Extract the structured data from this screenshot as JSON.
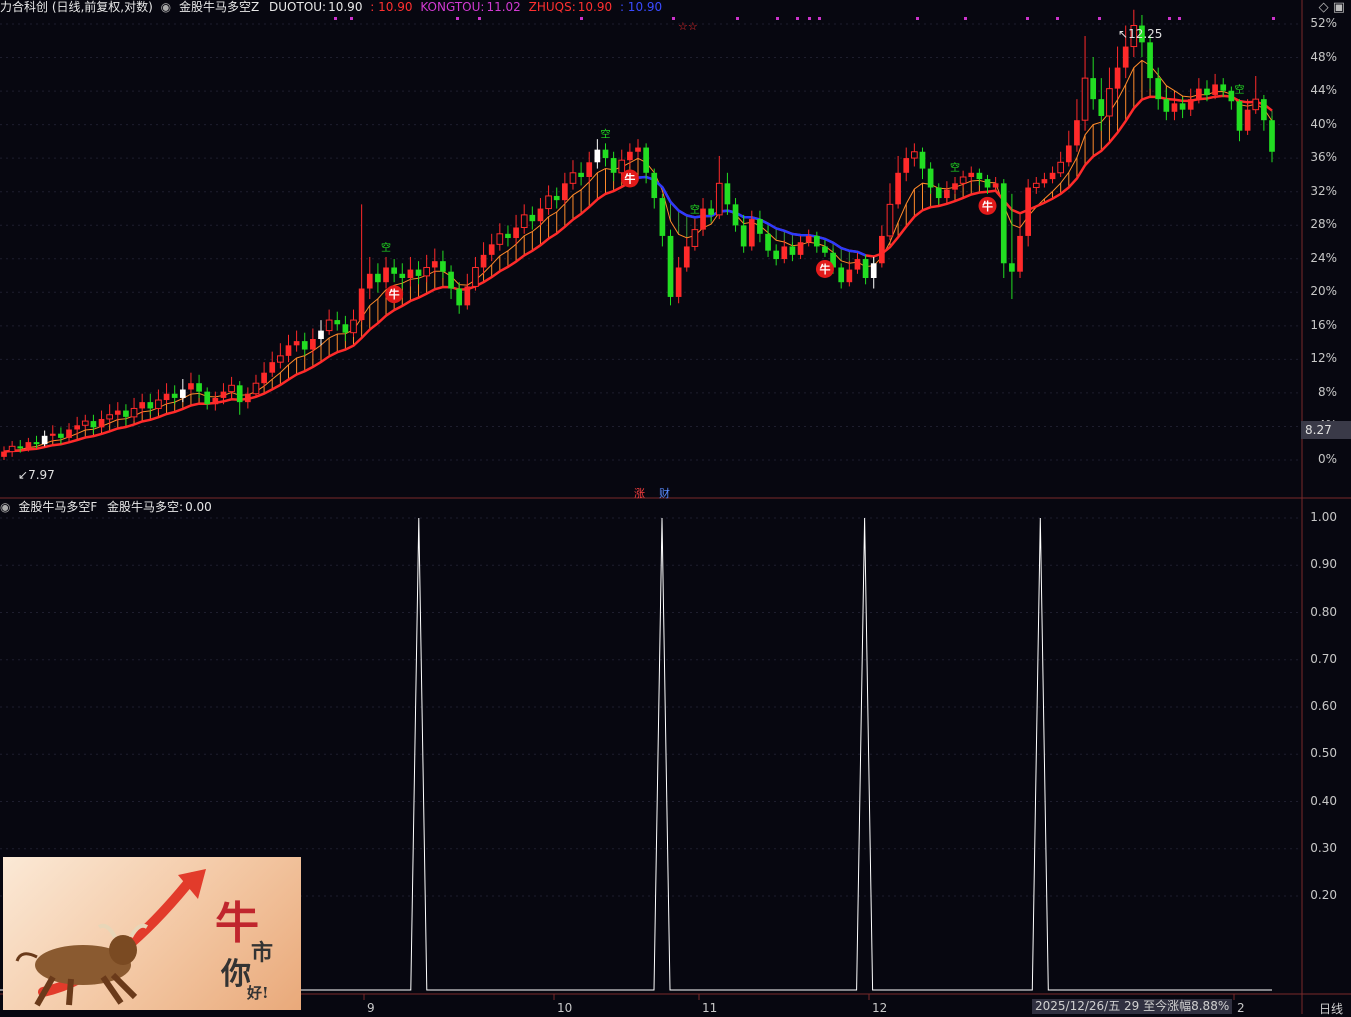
{
  "main_header": {
    "stock_title": "力合科创 (日线,前复权,对数)",
    "indicator_name": "金股牛马多空Z",
    "duotou_label": "DUOTOU:",
    "duotou_value": "10.90",
    "sep1": ": 10.90",
    "kongtou_label": "KONGTOU:",
    "kongtou_value": "11.02",
    "zhuqs_label": "ZHUQS:",
    "zhuqs_value": "10.90",
    "sep2": ": 10.90"
  },
  "sub_header": {
    "indicator_name": "金股牛马多空F",
    "value_label": "金股牛马多空:",
    "value": "0.00"
  },
  "price_axis_labels": [
    "52%",
    "48%",
    "44%",
    "40%",
    "36%",
    "32%",
    "28%",
    "24%",
    "20%",
    "16%",
    "12%",
    "8%",
    "4%",
    "0%"
  ],
  "current_price_badge": "8.27",
  "sub_axis_labels": [
    "1.00",
    "0.90",
    "0.80",
    "0.70",
    "0.60",
    "0.50",
    "0.40",
    "0.30",
    "0.20"
  ],
  "annotations": {
    "high_label": "12.25",
    "low_label": "7.97",
    "bull_marker": "牛",
    "kong_marker": "空",
    "stars": "☆☆",
    "zhang_tag": "涨",
    "cai_tag": "财"
  },
  "date_axis": {
    "labels": [
      "9",
      "10",
      "11",
      "12",
      "2"
    ],
    "status_text": "2025/12/26/五 29 至今涨幅8.88%",
    "period_button": "日线"
  },
  "promo": {
    "char1": "牛",
    "char2": "市",
    "char3": "你",
    "char4": "好!"
  },
  "colors": {
    "up": "#ff2a2a",
    "down": "#22dd22",
    "flat_white": "#ffffff",
    "magenta": "#cc33cc",
    "blue": "#2a3cff",
    "orange": "#ff8a2a"
  },
  "chart_data": [
    {
      "type": "candlestick",
      "title": "力合科创 (日线,前复权,对数)",
      "y_axis": "percent change",
      "ylim": [
        0,
        52
      ],
      "high_marker": 12.25,
      "low_marker": 7.97,
      "current": 8.27,
      "candles": [
        [
          8.0,
          8.05,
          7.97,
          8.1
        ],
        [
          8.05,
          8.1,
          8.0,
          8.15
        ],
        [
          8.1,
          8.08,
          8.04,
          8.16
        ],
        [
          8.08,
          8.14,
          8.05,
          8.18
        ],
        [
          8.14,
          8.12,
          8.08,
          8.2
        ],
        [
          8.12,
          8.2,
          8.1,
          8.25
        ],
        [
          8.2,
          8.22,
          8.15,
          8.3
        ],
        [
          8.22,
          8.18,
          8.12,
          8.28
        ],
        [
          8.18,
          8.26,
          8.15,
          8.32
        ],
        [
          8.26,
          8.3,
          8.2,
          8.38
        ],
        [
          8.3,
          8.34,
          8.26,
          8.4
        ],
        [
          8.34,
          8.28,
          8.22,
          8.4
        ],
        [
          8.28,
          8.36,
          8.24,
          8.44
        ],
        [
          8.36,
          8.4,
          8.3,
          8.5
        ],
        [
          8.4,
          8.44,
          8.34,
          8.52
        ],
        [
          8.44,
          8.38,
          8.3,
          8.5
        ],
        [
          8.38,
          8.46,
          8.34,
          8.56
        ],
        [
          8.46,
          8.52,
          8.4,
          8.6
        ],
        [
          8.52,
          8.46,
          8.4,
          8.6
        ],
        [
          8.46,
          8.54,
          8.42,
          8.64
        ],
        [
          8.54,
          8.6,
          8.5,
          8.7
        ],
        [
          8.6,
          8.56,
          8.5,
          8.68
        ],
        [
          8.56,
          8.64,
          8.52,
          8.74
        ],
        [
          8.64,
          8.7,
          8.6,
          8.8
        ],
        [
          8.7,
          8.62,
          8.56,
          8.78
        ],
        [
          8.62,
          8.5,
          8.45,
          8.66
        ],
        [
          8.5,
          8.56,
          8.44,
          8.62
        ],
        [
          8.56,
          8.62,
          8.5,
          8.7
        ],
        [
          8.62,
          8.68,
          8.56,
          8.76
        ],
        [
          8.68,
          8.52,
          8.4,
          8.72
        ],
        [
          8.52,
          8.6,
          8.46,
          8.66
        ],
        [
          8.6,
          8.7,
          8.56,
          8.78
        ],
        [
          8.7,
          8.8,
          8.66,
          8.9
        ],
        [
          8.8,
          8.9,
          8.76,
          9.0
        ],
        [
          8.9,
          8.96,
          8.84,
          9.08
        ],
        [
          8.96,
          9.06,
          8.9,
          9.16
        ],
        [
          9.06,
          9.1,
          9.0,
          9.2
        ],
        [
          9.1,
          9.02,
          8.96,
          9.18
        ],
        [
          9.02,
          9.12,
          8.98,
          9.22
        ],
        [
          9.12,
          9.2,
          9.06,
          9.3
        ],
        [
          9.2,
          9.3,
          9.16,
          9.4
        ],
        [
          9.3,
          9.26,
          9.2,
          9.38
        ],
        [
          9.26,
          9.18,
          9.1,
          9.34
        ],
        [
          9.18,
          9.3,
          9.14,
          9.4
        ],
        [
          9.3,
          9.6,
          9.28,
          10.4
        ],
        [
          9.6,
          9.74,
          9.5,
          9.9
        ],
        [
          9.74,
          9.66,
          9.56,
          9.84
        ],
        [
          9.66,
          9.8,
          9.6,
          9.9
        ],
        [
          9.8,
          9.74,
          9.66,
          9.88
        ],
        [
          9.74,
          9.7,
          9.6,
          9.84
        ],
        [
          9.7,
          9.78,
          9.62,
          9.9
        ],
        [
          9.78,
          9.72,
          9.64,
          9.86
        ],
        [
          9.72,
          9.8,
          9.66,
          9.92
        ],
        [
          9.8,
          9.86,
          9.74,
          9.98
        ],
        [
          9.86,
          9.76,
          9.7,
          9.96
        ],
        [
          9.76,
          9.6,
          9.5,
          9.82
        ],
        [
          9.6,
          9.44,
          9.36,
          9.66
        ],
        [
          9.44,
          9.62,
          9.4,
          9.74
        ],
        [
          9.62,
          9.8,
          9.58,
          9.9
        ],
        [
          9.8,
          9.92,
          9.74,
          10.04
        ],
        [
          9.92,
          10.02,
          9.86,
          10.12
        ],
        [
          10.02,
          10.12,
          9.96,
          10.22
        ],
        [
          10.12,
          10.08,
          10.0,
          10.2
        ],
        [
          10.08,
          10.18,
          10.02,
          10.3
        ],
        [
          10.18,
          10.3,
          10.12,
          10.4
        ],
        [
          10.3,
          10.24,
          10.16,
          10.38
        ],
        [
          10.24,
          10.36,
          10.2,
          10.46
        ],
        [
          10.36,
          10.48,
          10.3,
          10.58
        ],
        [
          10.48,
          10.44,
          10.36,
          10.56
        ],
        [
          10.44,
          10.6,
          10.4,
          10.7
        ],
        [
          10.6,
          10.7,
          10.54,
          10.82
        ],
        [
          10.7,
          10.66,
          10.58,
          10.8
        ],
        [
          10.66,
          10.8,
          10.6,
          10.9
        ],
        [
          10.8,
          10.92,
          10.74,
          11.02
        ],
        [
          10.92,
          10.84,
          10.76,
          10.98
        ],
        [
          10.84,
          10.7,
          10.62,
          10.9
        ],
        [
          10.7,
          10.82,
          10.66,
          10.92
        ],
        [
          10.82,
          10.9,
          10.76,
          10.98
        ],
        [
          10.9,
          10.94,
          10.84,
          11.02
        ],
        [
          10.94,
          10.7,
          10.6,
          10.98
        ],
        [
          10.7,
          10.46,
          10.36,
          10.74
        ],
        [
          10.46,
          10.1,
          10.0,
          10.5
        ],
        [
          10.1,
          9.52,
          9.44,
          10.16
        ],
        [
          9.52,
          9.8,
          9.46,
          9.9
        ],
        [
          9.8,
          10.0,
          9.76,
          10.08
        ],
        [
          10.0,
          10.16,
          9.96,
          10.26
        ],
        [
          10.16,
          10.36,
          10.1,
          10.46
        ],
        [
          10.36,
          10.3,
          10.24,
          10.44
        ],
        [
          10.3,
          10.6,
          10.26,
          10.86
        ],
        [
          10.6,
          10.4,
          10.3,
          10.7
        ],
        [
          10.4,
          10.2,
          10.14,
          10.46
        ],
        [
          10.2,
          10.0,
          9.94,
          10.3
        ],
        [
          10.0,
          10.26,
          9.96,
          10.34
        ],
        [
          10.26,
          10.12,
          10.04,
          10.34
        ],
        [
          10.12,
          9.96,
          9.9,
          10.2
        ],
        [
          9.96,
          9.88,
          9.82,
          10.02
        ],
        [
          9.88,
          10.0,
          9.84,
          10.06
        ],
        [
          10.0,
          9.92,
          9.86,
          10.04
        ],
        [
          9.92,
          10.04,
          9.88,
          10.1
        ],
        [
          10.04,
          10.1,
          10.0,
          10.16
        ],
        [
          10.1,
          10.0,
          9.94,
          10.14
        ],
        [
          10.0,
          9.94,
          9.9,
          10.06
        ],
        [
          9.94,
          9.8,
          9.74,
          9.98
        ],
        [
          9.8,
          9.66,
          9.6,
          9.84
        ],
        [
          9.66,
          9.78,
          9.62,
          9.86
        ],
        [
          9.78,
          9.88,
          9.74,
          9.94
        ],
        [
          9.88,
          9.7,
          9.64,
          9.92
        ],
        [
          9.7,
          9.84,
          9.6,
          9.9
        ],
        [
          9.84,
          10.1,
          9.8,
          10.2
        ],
        [
          10.1,
          10.4,
          10.06,
          10.6
        ],
        [
          10.4,
          10.7,
          10.36,
          10.86
        ],
        [
          10.7,
          10.84,
          10.62,
          10.94
        ],
        [
          10.84,
          10.9,
          10.76,
          10.98
        ],
        [
          10.9,
          10.74,
          10.64,
          10.94
        ],
        [
          10.74,
          10.56,
          10.5,
          10.8
        ],
        [
          10.56,
          10.46,
          10.4,
          10.6
        ],
        [
          10.46,
          10.54,
          10.4,
          10.62
        ],
        [
          10.54,
          10.6,
          10.5,
          10.66
        ],
        [
          10.6,
          10.66,
          10.56,
          10.72
        ],
        [
          10.66,
          10.7,
          10.6,
          10.76
        ],
        [
          10.7,
          10.64,
          10.58,
          10.74
        ],
        [
          10.64,
          10.56,
          10.5,
          10.68
        ],
        [
          10.56,
          10.6,
          10.52,
          10.66
        ],
        [
          10.6,
          9.84,
          9.7,
          10.64
        ],
        [
          9.84,
          9.76,
          9.5,
          10.5
        ],
        [
          9.76,
          10.1,
          9.7,
          10.3
        ],
        [
          10.1,
          10.56,
          10.0,
          10.64
        ],
        [
          10.56,
          10.6,
          10.5,
          10.66
        ],
        [
          10.6,
          10.64,
          10.56,
          10.7
        ],
        [
          10.64,
          10.7,
          10.6,
          10.76
        ],
        [
          10.7,
          10.8,
          10.66,
          10.9
        ],
        [
          10.8,
          10.96,
          10.76,
          11.1
        ],
        [
          10.96,
          11.2,
          10.9,
          11.4
        ],
        [
          11.2,
          11.6,
          11.1,
          12.0
        ],
        [
          11.6,
          11.4,
          11.3,
          11.8
        ],
        [
          11.4,
          11.24,
          11.1,
          11.6
        ],
        [
          11.24,
          11.5,
          11.2,
          11.7
        ],
        [
          11.5,
          11.7,
          11.4,
          11.9
        ],
        [
          11.7,
          11.9,
          11.6,
          12.1
        ],
        [
          11.9,
          12.1,
          11.8,
          12.25
        ],
        [
          12.1,
          11.94,
          11.8,
          12.2
        ],
        [
          11.94,
          11.6,
          11.5,
          12.0
        ],
        [
          11.6,
          11.4,
          11.3,
          11.7
        ],
        [
          11.4,
          11.28,
          11.2,
          11.5
        ],
        [
          11.28,
          11.36,
          11.2,
          11.46
        ],
        [
          11.36,
          11.3,
          11.22,
          11.42
        ],
        [
          11.3,
          11.4,
          11.24,
          11.5
        ],
        [
          11.4,
          11.5,
          11.36,
          11.6
        ],
        [
          11.5,
          11.44,
          11.38,
          11.58
        ],
        [
          11.44,
          11.54,
          11.4,
          11.64
        ],
        [
          11.54,
          11.48,
          11.42,
          11.6
        ],
        [
          11.48,
          11.38,
          11.3,
          11.52
        ],
        [
          11.38,
          11.1,
          11.0,
          11.4
        ],
        [
          11.1,
          11.3,
          11.06,
          11.4
        ],
        [
          11.3,
          11.4,
          11.26,
          11.62
        ],
        [
          11.4,
          11.2,
          11.1,
          11.44
        ],
        [
          11.2,
          10.9,
          10.8,
          11.24
        ]
      ]
    },
    {
      "type": "line",
      "title": "金股牛马多空F",
      "ylim": [
        0,
        1
      ],
      "series": [
        {
          "name": "金股牛马多空",
          "spikes_at_fraction": [
            0.31,
            0.49,
            0.64,
            0.77
          ],
          "baseline": 0,
          "peak": 1
        }
      ]
    }
  ]
}
